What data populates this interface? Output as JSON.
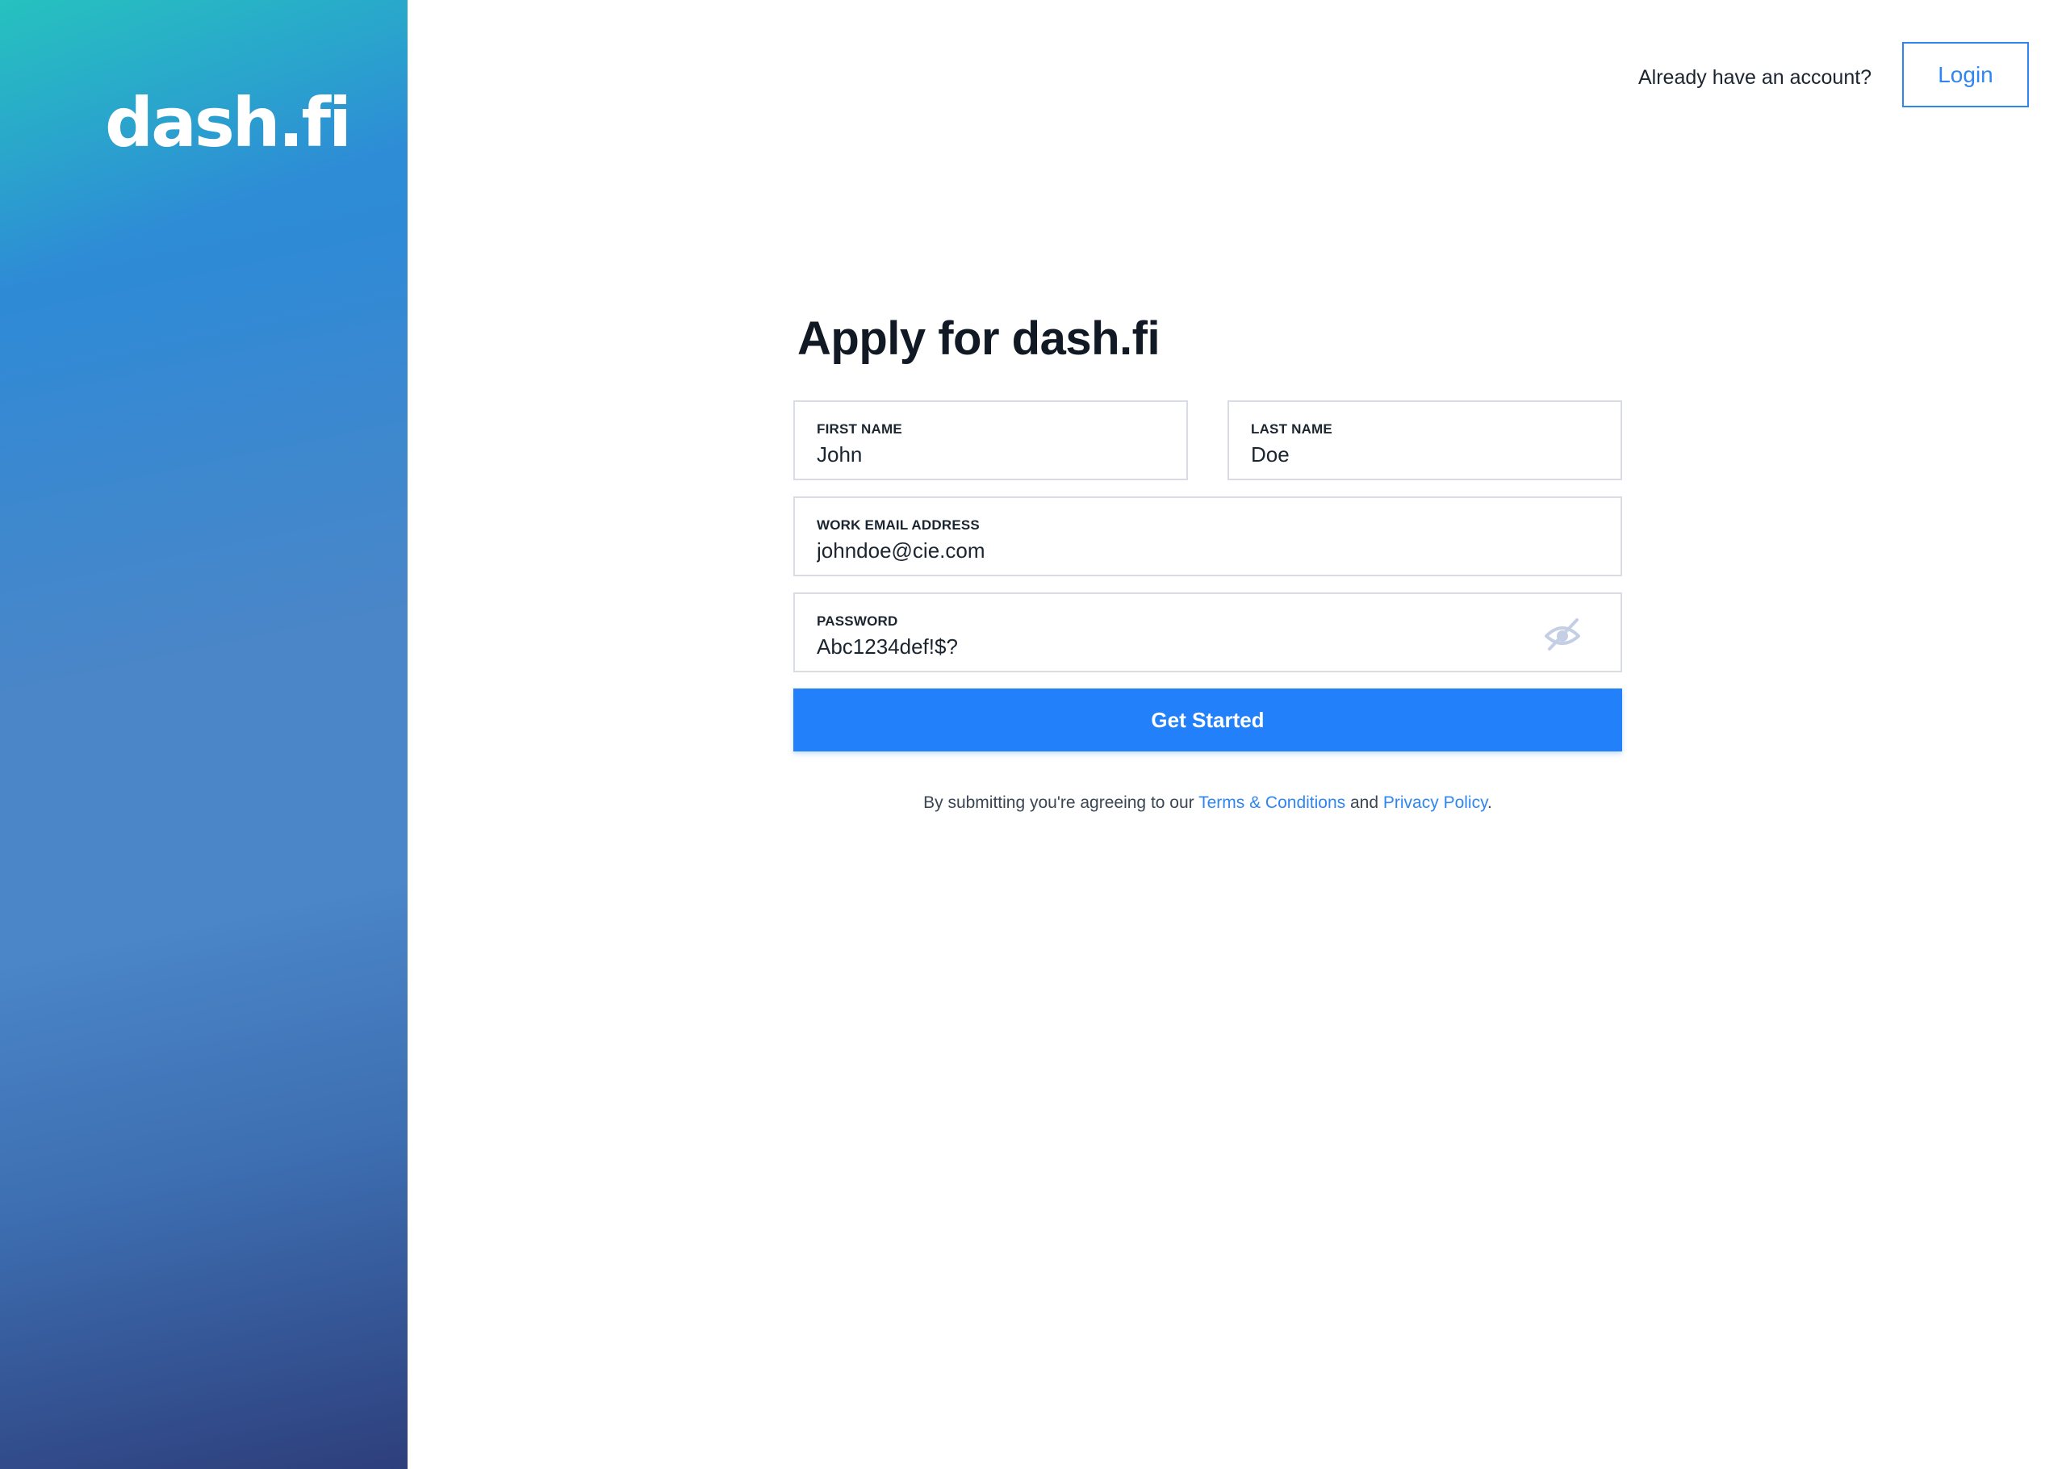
{
  "brand": {
    "logo_text": "dash.fi"
  },
  "header": {
    "prompt": "Already have an account?",
    "login_label": "Login"
  },
  "form": {
    "title": "Apply for dash.fi",
    "fields": {
      "first_name": {
        "label": "FIRST NAME",
        "value": "John"
      },
      "last_name": {
        "label": "LAST NAME",
        "value": "Doe"
      },
      "email": {
        "label": "WORK EMAIL ADDRESS",
        "value": "johndoe@cie.com"
      },
      "password": {
        "label": "PASSWORD",
        "value": "Abc1234def!$?",
        "toggle_icon": "eye-slash-icon"
      }
    },
    "submit_label": "Get Started"
  },
  "legal": {
    "prefix": "By submitting you're agreeing to our ",
    "terms_link": "Terms & Conditions",
    "middle": " and ",
    "privacy_link": "Privacy Policy",
    "suffix": "."
  },
  "colors": {
    "primary": "#2280fb",
    "link": "#2f86ee",
    "border": "#d9dde3",
    "sidebar_top": "#26c4be",
    "sidebar_mid": "#4a86c8",
    "sidebar_bottom": "#2e3f7c"
  }
}
